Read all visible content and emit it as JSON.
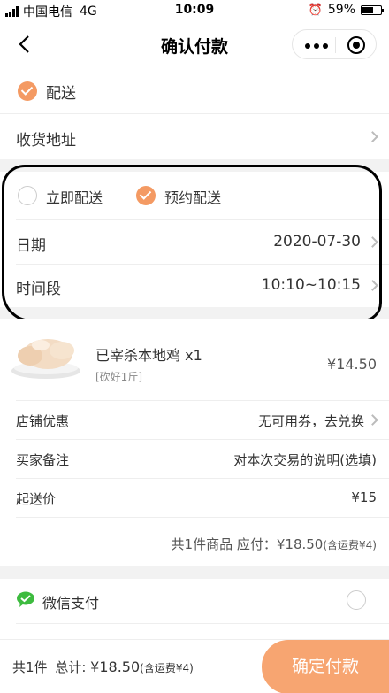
{
  "status_bar": {
    "carrier": "中国电信",
    "network": "4G",
    "time": "10:09",
    "battery": "59%"
  },
  "nav": {
    "title": "确认付款"
  },
  "delivery": {
    "mode_label": "配送",
    "address_label": "收货地址",
    "option_immediate": "立即配送",
    "option_scheduled": "预约配送",
    "date_label": "日期",
    "date_value": "2020-07-30",
    "time_label": "时间段",
    "time_value": "10:10~10:15"
  },
  "product": {
    "name": "已宰杀本地鸡",
    "quantity": "x1",
    "spec": "[砍好1斤]",
    "price": "¥14.50"
  },
  "order": {
    "coupon_label": "店铺优惠",
    "coupon_value": "无可用券，去兑换",
    "note_label": "买家备注",
    "note_placeholder": "对本次交易的说明(选填)",
    "min_label": "起送价",
    "min_value": "¥15",
    "summary_main": "共1件商品  应付：¥18.50",
    "summary_sub": "(含运费¥4)"
  },
  "payment": {
    "wechat_label": "微信支付"
  },
  "bottom": {
    "count": "共1件",
    "total_label": "总计:",
    "total_value": "¥18.50",
    "shipping_note": "(含运费¥4)",
    "pay_button": "确定付款"
  },
  "colors": {
    "accent": "#f49a63",
    "pay_button": "#f7a571",
    "wechat": "#3dbb3f"
  }
}
